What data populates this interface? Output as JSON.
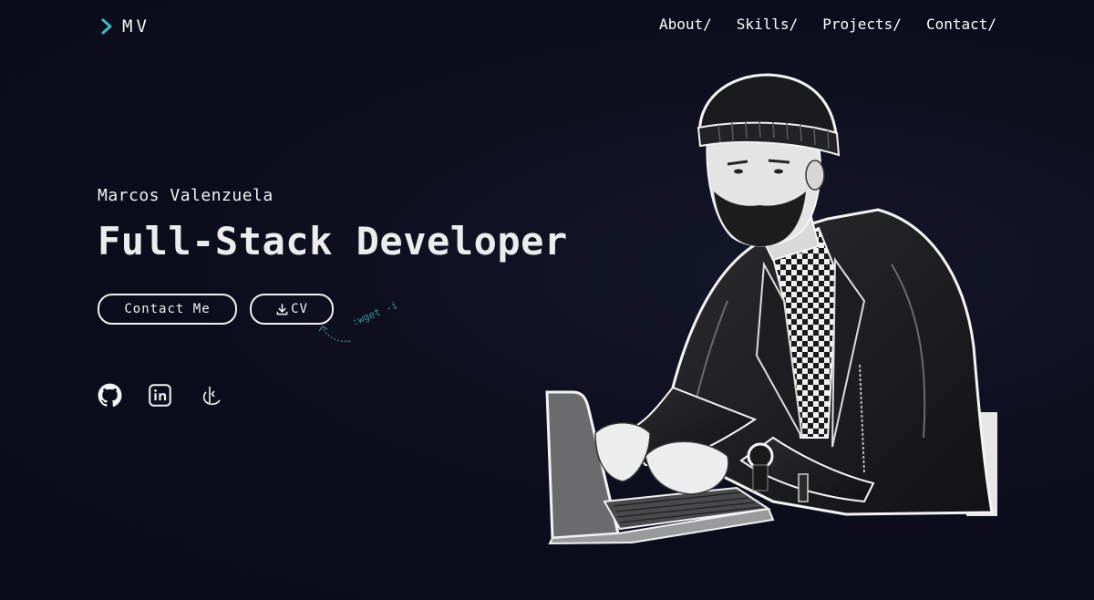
{
  "header": {
    "logo_text": "MV",
    "accent_color": "#3fb8c8",
    "nav": [
      {
        "label": "About/"
      },
      {
        "label": "Skills/"
      },
      {
        "label": "Projects/"
      },
      {
        "label": "Contact/"
      }
    ]
  },
  "hero": {
    "name": "Marcos Valenzuela",
    "title": "Full-Stack Developer",
    "contact_button": "Contact Me",
    "cv_button": "CV",
    "cv_icon": "download-icon",
    "cv_hint": ":wget -i"
  },
  "social": [
    {
      "icon": "github-icon"
    },
    {
      "icon": "linkedin-icon"
    },
    {
      "icon": "kaggle-icon"
    }
  ],
  "portrait": {
    "icon": "developer-portrait-illustration"
  }
}
